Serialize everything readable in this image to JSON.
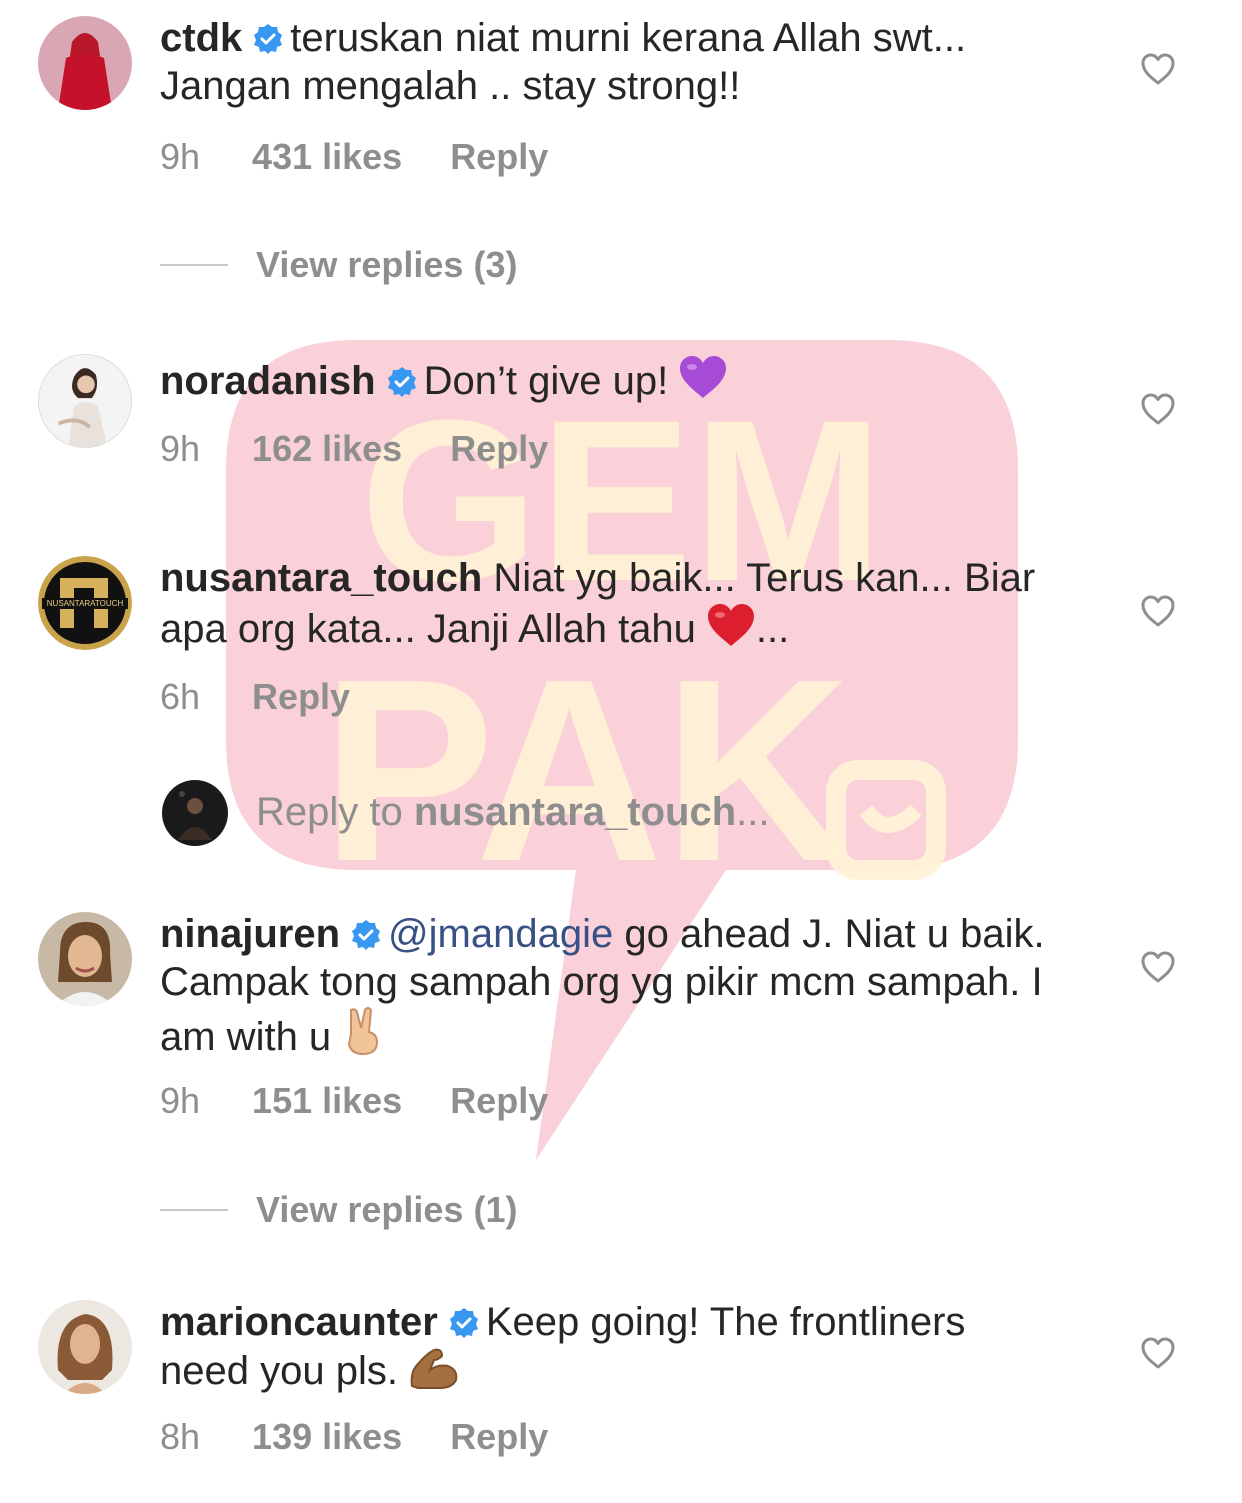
{
  "watermark": {
    "brand_text_top": "GEM",
    "brand_text_bottom": "PAK",
    "bubble_color": "#f9c8d2",
    "text_color": "#fff3d6"
  },
  "comments": [
    {
      "username": "ctdk",
      "verified": true,
      "text": "teruskan niat murni kerana Allah swt... Jangan mengalah .. stay strong!!",
      "time": "9h",
      "likes": "431 likes",
      "reply_label": "Reply",
      "avatar": "woman-red-hijab"
    },
    {
      "username": "noradanish",
      "verified": true,
      "text": "Don’t give up!",
      "emoji": "purple-heart",
      "time": "9h",
      "likes": "162 likes",
      "reply_label": "Reply",
      "avatar": "woman-portrait"
    },
    {
      "username": "nusantara_touch",
      "verified": false,
      "text": "Niat yg baik... Terus kan... Biar apa org kata... Janji Allah tahu",
      "emoji": "red-heart",
      "text_suffix": "...",
      "time": "6h",
      "reply_label": "Reply",
      "avatar": "nusantara-touch-logo",
      "avatar_text": "NUSANTARATOUCH"
    },
    {
      "username": "ninajuren",
      "verified": true,
      "mention": "@jmandagie",
      "text": "go ahead J. Niat u baik. Campak tong sampah org yg pikir mcm sampah. I am with u",
      "emoji": "victory-hand",
      "time": "9h",
      "likes": "151 likes",
      "reply_label": "Reply",
      "avatar": "woman-smiling"
    },
    {
      "username": "marioncaunter",
      "verified": true,
      "text": "Keep going! The frontliners need you pls.",
      "emoji": "flexed-biceps",
      "time": "8h",
      "likes": "139 likes",
      "reply_label": "Reply",
      "avatar": "woman-long-hair"
    }
  ],
  "view_replies": [
    {
      "label": "View replies (3)"
    },
    {
      "label": "View replies (1)"
    }
  ],
  "reply_to": {
    "prefix": "Reply to ",
    "username": "nusantara_touch",
    "suffix": "..."
  },
  "icons": {
    "like": "heart-outline-icon",
    "verified": "verified-badge-icon"
  },
  "colors": {
    "text": "#262626",
    "meta": "#8e8e8e",
    "verified": "#3897f0",
    "mention": "#385185"
  }
}
